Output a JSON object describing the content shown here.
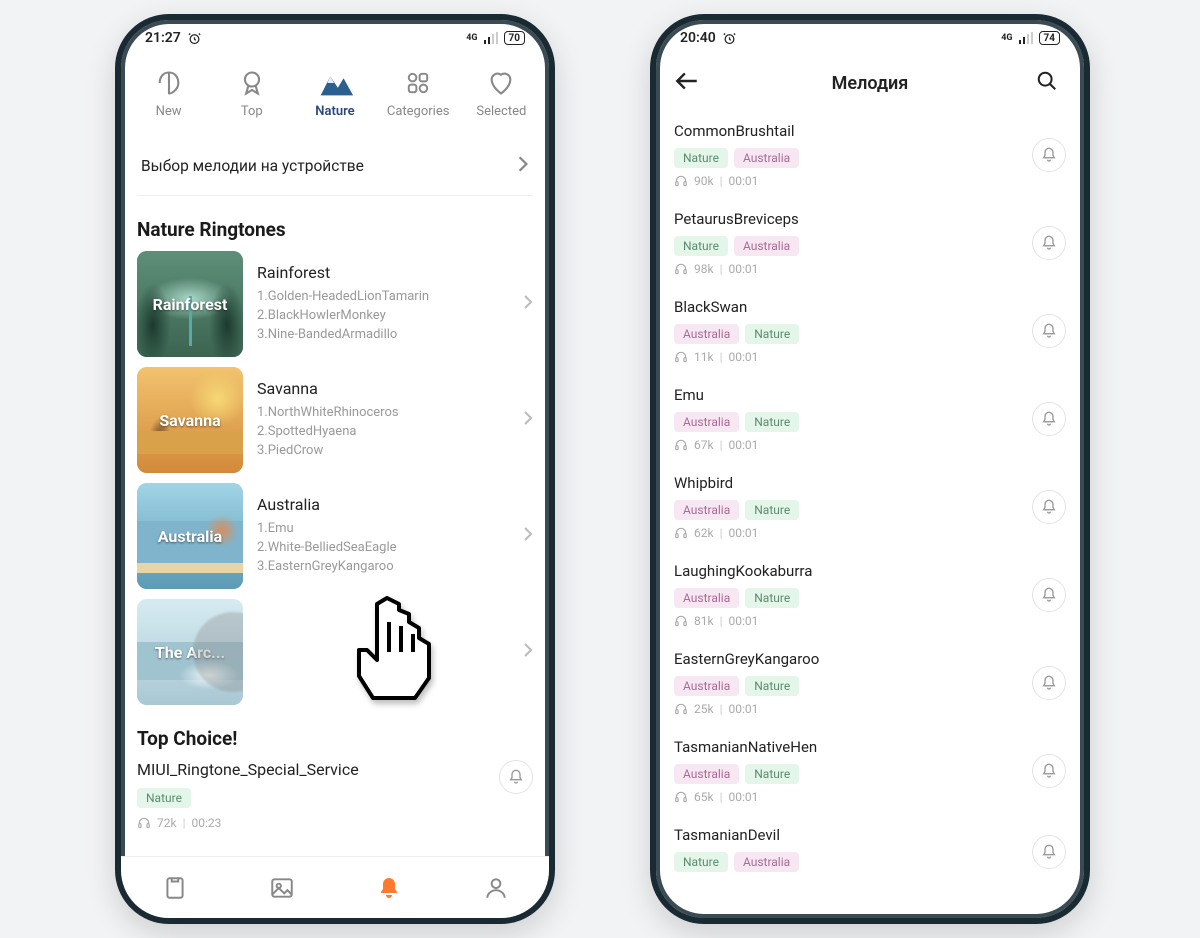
{
  "left": {
    "status": {
      "time": "21:27",
      "battery": "70"
    },
    "tabs": [
      "New",
      "Top",
      "Nature",
      "Categories",
      "Selected"
    ],
    "active_tab_index": 2,
    "device_row": "Выбор мелодии на устройстве",
    "section_title": "Nature Ringtones",
    "collections": [
      {
        "title": "Rainforest",
        "thumb_label": "Rainforest",
        "items": [
          "1.Golden-HeadedLionTamarin",
          "2.BlackHowlerMonkey",
          "3.Nine-BandedArmadillo"
        ],
        "thumb_class": "thumb-rainforest"
      },
      {
        "title": "Savanna",
        "thumb_label": "Savanna",
        "items": [
          "1.NorthWhiteRhinoceros",
          "2.SpottedHyaena",
          "3.PiedCrow"
        ],
        "thumb_class": "thumb-savanna"
      },
      {
        "title": "Australia",
        "thumb_label": "Australia",
        "items": [
          "1.Emu",
          "2.White-BelliedSeaEagle",
          "3.EasternGreyKangaroo"
        ],
        "thumb_class": "thumb-australia"
      },
      {
        "title": "",
        "thumb_label": "The Arc...",
        "items": [
          "",
          "",
          ""
        ],
        "thumb_class": "thumb-arctic"
      }
    ],
    "top_choice_title": "Top Choice!",
    "top_choice_item": {
      "title": "MIUI_Ringtone_Special_Service",
      "tags": [
        {
          "label": "Nature",
          "cls": "tag-nature"
        }
      ],
      "plays": "72k",
      "duration": "00:23"
    }
  },
  "right": {
    "status": {
      "time": "20:40",
      "battery": "74"
    },
    "title": "Мелодия",
    "tracks": [
      {
        "title": "CommonBrushtail",
        "tags": [
          {
            "label": "Nature",
            "cls": "tag-nature"
          },
          {
            "label": "Australia",
            "cls": "tag-australia"
          }
        ],
        "plays": "90k",
        "duration": "00:01"
      },
      {
        "title": "PetaurusBreviceps",
        "tags": [
          {
            "label": "Nature",
            "cls": "tag-nature"
          },
          {
            "label": "Australia",
            "cls": "tag-australia"
          }
        ],
        "plays": "98k",
        "duration": "00:01"
      },
      {
        "title": "BlackSwan",
        "tags": [
          {
            "label": "Australia",
            "cls": "tag-australia"
          },
          {
            "label": "Nature",
            "cls": "tag-nature"
          }
        ],
        "plays": "11k",
        "duration": "00:01"
      },
      {
        "title": "Emu",
        "tags": [
          {
            "label": "Australia",
            "cls": "tag-australia"
          },
          {
            "label": "Nature",
            "cls": "tag-nature"
          }
        ],
        "plays": "67k",
        "duration": "00:01"
      },
      {
        "title": "Whipbird",
        "tags": [
          {
            "label": "Australia",
            "cls": "tag-australia"
          },
          {
            "label": "Nature",
            "cls": "tag-nature"
          }
        ],
        "plays": "62k",
        "duration": "00:01"
      },
      {
        "title": "LaughingKookaburra",
        "tags": [
          {
            "label": "Australia",
            "cls": "tag-australia"
          },
          {
            "label": "Nature",
            "cls": "tag-nature"
          }
        ],
        "plays": "81k",
        "duration": "00:01"
      },
      {
        "title": "EasternGreyKangaroo",
        "tags": [
          {
            "label": "Australia",
            "cls": "tag-australia"
          },
          {
            "label": "Nature",
            "cls": "tag-nature"
          }
        ],
        "plays": "25k",
        "duration": "00:01"
      },
      {
        "title": "TasmanianNativeHen",
        "tags": [
          {
            "label": "Australia",
            "cls": "tag-australia"
          },
          {
            "label": "Nature",
            "cls": "tag-nature"
          }
        ],
        "plays": "65k",
        "duration": "00:01"
      },
      {
        "title": "TasmanianDevil",
        "tags": [
          {
            "label": "Nature",
            "cls": "tag-nature"
          },
          {
            "label": "Australia",
            "cls": "tag-australia"
          }
        ],
        "plays": "",
        "duration": ""
      }
    ]
  }
}
